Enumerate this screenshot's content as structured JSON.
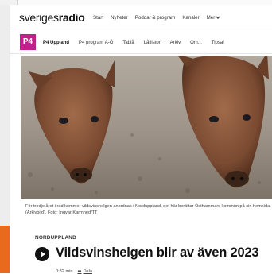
{
  "header": {
    "logo_prefix": "sveriges",
    "logo_bold": "radio",
    "nav": [
      "Start",
      "Nyheter",
      "Poddar & program",
      "Kanaler",
      "Mer"
    ]
  },
  "channel": {
    "logo_text": "P4",
    "name": "P4 Uppland",
    "nav": [
      "P4 program A-Ö",
      "Tablå",
      "Låtlistor",
      "Arkiv",
      "Om...",
      "Tipsa!"
    ]
  },
  "article": {
    "caption": "För tredje året i rad kommer vildsvinshelgen anordnas i Norduppland, det här berättar Östhammars kommun på sin hemsida. (Arkivbild). Foto: Ingvar Karmhed/TT",
    "region": "NORDUPPLAND",
    "headline": "Vildsvinshelgen blir av även 2023",
    "duration": "0:32 min",
    "share_label": "Dela"
  },
  "colors": {
    "p4_brand": "#c1218d",
    "accent_orange": "#ea6a1d"
  }
}
